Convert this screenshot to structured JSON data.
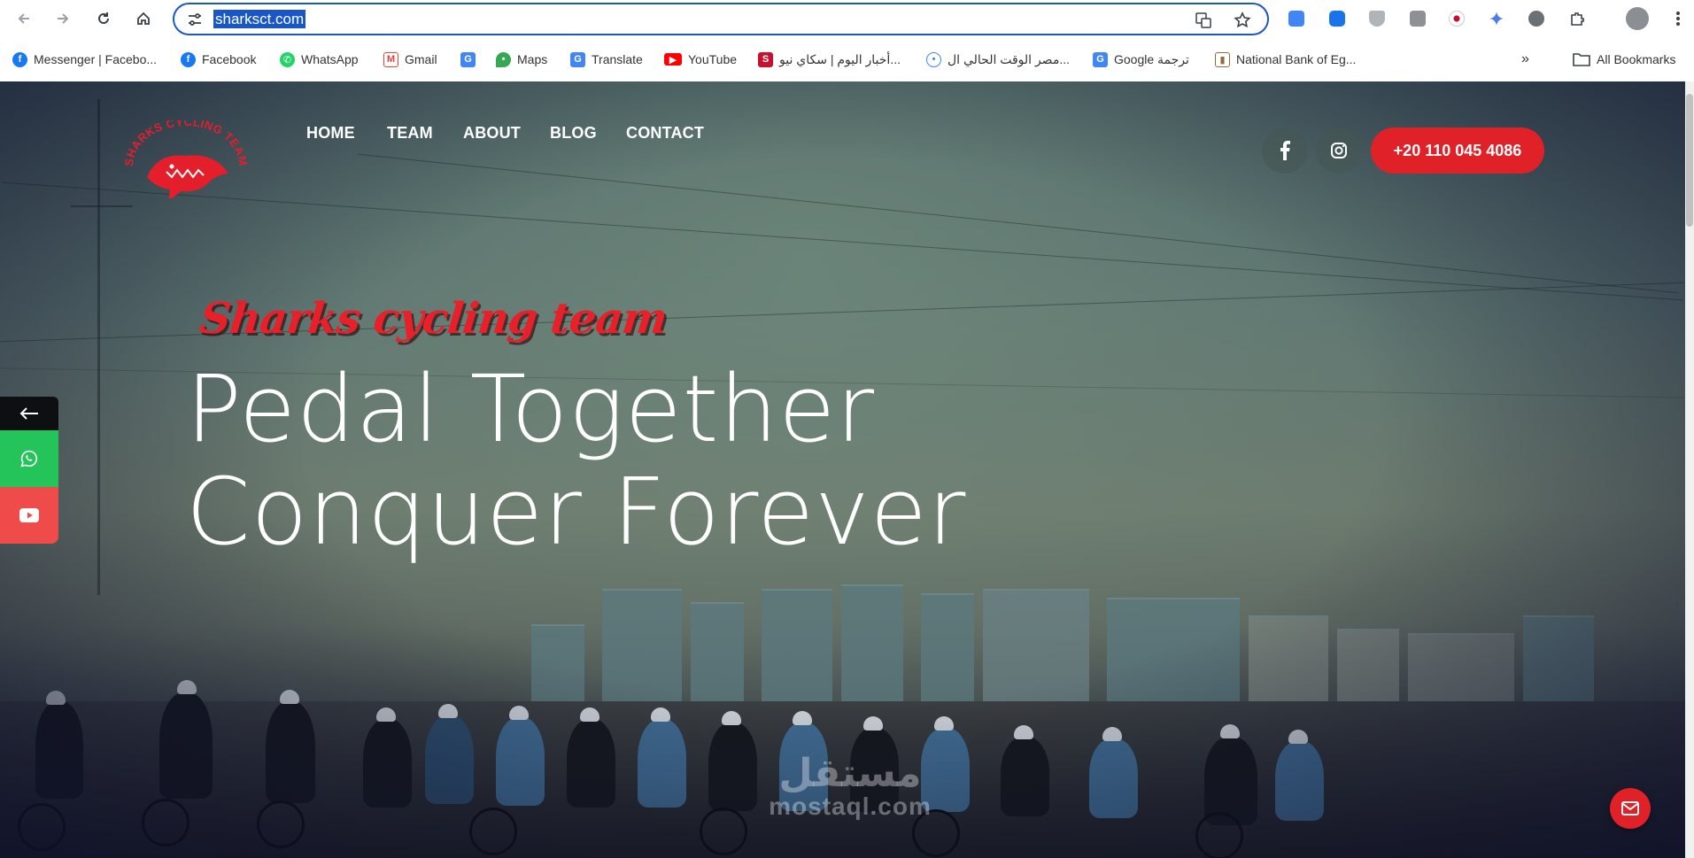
{
  "browser": {
    "url": "sharksct.com",
    "bookmarks": [
      {
        "label": "Messenger | Facebo...",
        "icon": "facebook-icon",
        "color": "#1877f2"
      },
      {
        "label": "Facebook",
        "icon": "facebook-icon",
        "color": "#1877f2"
      },
      {
        "label": "WhatsApp",
        "icon": "whatsapp-icon",
        "color": "#25d366"
      },
      {
        "label": "Gmail",
        "icon": "gmail-icon",
        "color": "#ea4335"
      },
      {
        "label": "",
        "icon": "google-translate-icon",
        "color": "#4285f4"
      },
      {
        "label": "Maps",
        "icon": "maps-icon",
        "color": "#34a853"
      },
      {
        "label": "Translate",
        "icon": "google-translate-icon",
        "color": "#4285f4"
      },
      {
        "label": "YouTube",
        "icon": "youtube-icon",
        "color": "#ff0000"
      },
      {
        "label": "أخبار اليوم | سكاي نيو...",
        "icon": "skynews-icon",
        "color": "#c8102e"
      },
      {
        "label": "مصر الوقت الحالي ال...",
        "icon": "location-icon",
        "color": "#4285f4"
      },
      {
        "label": "Google ترجمة",
        "icon": "google-translate-icon",
        "color": "#4285f4"
      },
      {
        "label": "National Bank of Eg...",
        "icon": "bank-icon",
        "color": "#8a6d3b"
      }
    ],
    "all_bookmarks": "All Bookmarks"
  },
  "site": {
    "logo_text": "SHARKS CYCLING TEAM",
    "nav": [
      "HOME",
      "TEAM",
      "ABOUT",
      "BLOG",
      "CONTACT"
    ],
    "active_nav": "HOME",
    "phone": "+20 110 045 4086",
    "tagline": "Sharks cycling team",
    "headline_line1": "Pedal Together",
    "headline_line2": "Conquer Forever",
    "watermark_ar": "مستقل",
    "watermark_en": "mostaql.com",
    "colors": {
      "accent": "#e02128",
      "whatsapp": "#25d366",
      "youtube": "#ef4b4b",
      "url_highlight": "#1a57c6"
    }
  }
}
